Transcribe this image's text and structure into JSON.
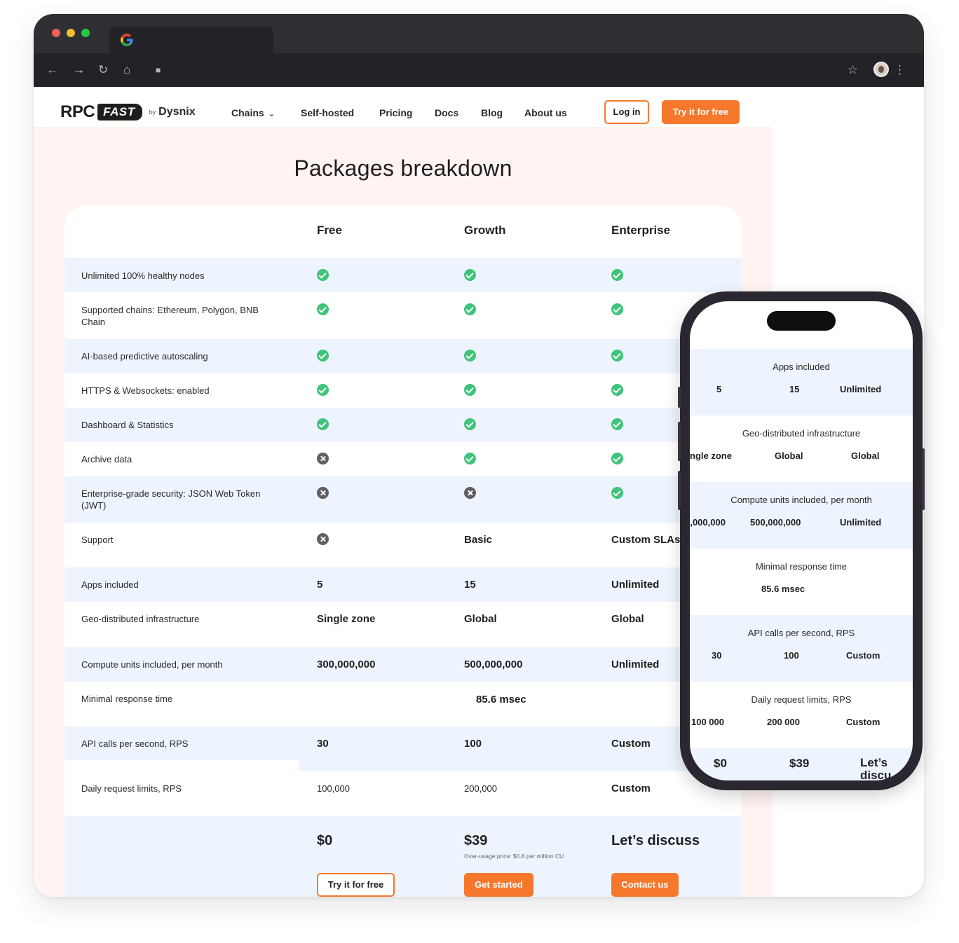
{
  "nav": {
    "logo_rpc": "RPC",
    "logo_fast": "FAST",
    "logo_by": "by",
    "logo_dysnix": "Dysnix",
    "items": [
      "Chains",
      "Self-hosted",
      "Pricing",
      "Docs",
      "Blog",
      "About us"
    ],
    "login": "Log in",
    "try": "Try it for free"
  },
  "heading": "Packages breakdown",
  "plans": [
    "Free",
    "Growth",
    "Enterprise"
  ],
  "features": [
    {
      "label": "Unlimited 100% healthy nodes",
      "values": [
        "check",
        "check",
        "check"
      ]
    },
    {
      "label": "Supported chains: Ethereum, Polygon, BNB Chain",
      "values": [
        "check",
        "check",
        "check"
      ]
    },
    {
      "label": "AI-based predictive autoscaling",
      "values": [
        "check",
        "check",
        "check"
      ]
    },
    {
      "label": "HTTPS & Websockets: enabled",
      "values": [
        "check",
        "check",
        "check"
      ]
    },
    {
      "label": "Dashboard & Statistics",
      "values": [
        "check",
        "check",
        "check"
      ]
    },
    {
      "label": "Archive data",
      "values": [
        "cross",
        "check",
        "check"
      ]
    },
    {
      "label": "Enterprise-grade security: JSON Web Token (JWT)",
      "values": [
        "cross",
        "cross",
        "check"
      ]
    },
    {
      "label": "Support",
      "values": [
        "cross",
        "Basic",
        "Custom SLAs"
      ]
    },
    {
      "label": "Apps included",
      "values": [
        "5",
        "15",
        "Unlimited"
      ]
    },
    {
      "label": "Geo-distributed infrastructure",
      "values": [
        "Single zone",
        "Global",
        "Global"
      ]
    },
    {
      "label": "Compute units included, per month",
      "values": [
        "300,000,000",
        "500,000,000",
        "Unlimited"
      ]
    },
    {
      "label": "Minimal response time",
      "values": [
        "",
        "85.6 msec",
        ""
      ]
    },
    {
      "label": "API calls per second, RPS",
      "values": [
        "30",
        "100",
        "Custom"
      ]
    },
    {
      "label": "Daily request limits, RPS",
      "values": [
        "100,000",
        "200,000",
        "Custom"
      ]
    }
  ],
  "pricing": {
    "free_price": "$0",
    "growth_price": "$39",
    "growth_note": "Over-usage price: $0.8 per million CU",
    "enterprise_price": "Let’s discuss",
    "free_button": "Try it for free",
    "growth_button": "Get started",
    "enterprise_button": "Contact us"
  },
  "mobile": {
    "sections": [
      {
        "title": "Apps included",
        "values": [
          "5",
          "15",
          "Unlimited"
        ]
      },
      {
        "title": "Geo-distributed infrastructure",
        "values": [
          "ngle zone",
          "Global",
          "Global"
        ]
      },
      {
        "title": "Compute units included, per month",
        "values": [
          "),000,000",
          "500,000,000",
          "Unlimited"
        ]
      },
      {
        "title": "Minimal response time",
        "values": [
          "85.6 msec"
        ]
      },
      {
        "title": "API calls per second, RPS",
        "values": [
          "30",
          "100",
          "Custom"
        ]
      },
      {
        "title": "Daily request limits, RPS",
        "values": [
          "100 000",
          "200 000",
          "Custom"
        ]
      }
    ],
    "prices": [
      "$0",
      "$39",
      "Let’s discu"
    ]
  },
  "colors": {
    "accent": "#f5782d",
    "check": "#3fc47a",
    "cross": "#5e5e63",
    "row_blue": "#edf4fd",
    "page_bg": "#fff4f1"
  }
}
